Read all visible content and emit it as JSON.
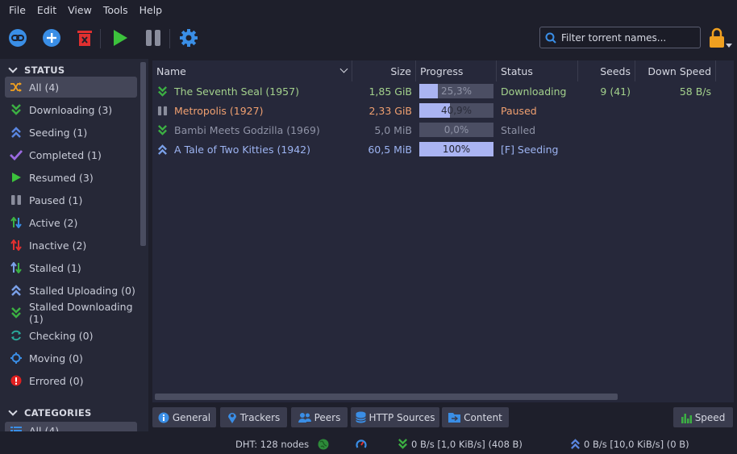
{
  "menu": [
    "File",
    "Edit",
    "View",
    "Tools",
    "Help"
  ],
  "toolbar": {
    "search_placeholder": "Filter torrent names..."
  },
  "sidebar": {
    "status_header": "STATUS",
    "status_items": [
      {
        "label": "All (4)",
        "icon": "shuffle-icon",
        "selected": true
      },
      {
        "label": "Downloading (3)",
        "icon": "download-icon"
      },
      {
        "label": "Seeding (1)",
        "icon": "upload-icon"
      },
      {
        "label": "Completed (1)",
        "icon": "check-icon"
      },
      {
        "label": "Resumed (3)",
        "icon": "play-icon"
      },
      {
        "label": "Paused (1)",
        "icon": "pause-icon"
      },
      {
        "label": "Active (2)",
        "icon": "active-arrows-icon"
      },
      {
        "label": "Inactive (2)",
        "icon": "inactive-arrows-icon"
      },
      {
        "label": "Stalled (1)",
        "icon": "stalled-arrows-icon"
      },
      {
        "label": "Stalled Uploading (0)",
        "icon": "stalled-upload-icon"
      },
      {
        "label": "Stalled Downloading (1)",
        "icon": "stalled-download-icon"
      },
      {
        "label": "Checking (0)",
        "icon": "checking-icon"
      },
      {
        "label": "Moving (0)",
        "icon": "moving-icon"
      },
      {
        "label": "Errored (0)",
        "icon": "error-icon"
      }
    ],
    "categories_header": "CATEGORIES",
    "categories_items": [
      {
        "label": "All (4)"
      }
    ]
  },
  "table": {
    "columns": [
      "Name",
      "Size",
      "Progress",
      "Status",
      "Seeds",
      "Down Speed"
    ],
    "rows": [
      {
        "name": "The Seventh Seal (1957)",
        "size": "1,85 GiB",
        "progress": 0.253,
        "progress_text": "25,3%",
        "status": "Downloading",
        "seeds": "9 (41)",
        "down_speed": "58 B/s",
        "color": "#a3d18c",
        "icon": "download-icon"
      },
      {
        "name": "Metropolis (1927)",
        "size": "2,33 GiB",
        "progress": 0.409,
        "progress_text": "40,9%",
        "status": "Paused",
        "seeds": "",
        "down_speed": "",
        "color": "#f0a070",
        "icon": "pause-icon"
      },
      {
        "name": "Bambi Meets Godzilla (1969)",
        "size": "5,0 MiB",
        "progress": 0.0,
        "progress_text": "0,0%",
        "status": "Stalled",
        "seeds": "",
        "down_speed": "",
        "color": "#8f93a6",
        "icon": "stalled-download-icon"
      },
      {
        "name": "A Tale of Two Kitties (1942)",
        "size": "60,5 MiB",
        "progress": 1.0,
        "progress_text": "100%",
        "status": "[F] Seeding",
        "seeds": "",
        "down_speed": "",
        "color": "#9db4f2",
        "icon": "upload-icon"
      }
    ]
  },
  "tabs": [
    "General",
    "Trackers",
    "Peers",
    "HTTP Sources",
    "Content"
  ],
  "speed_button": "Speed",
  "statusbar": {
    "dht": "DHT: 128 nodes",
    "download": "0 B/s [1,0 KiB/s] (408 B)",
    "upload": "0 B/s [10,0 KiB/s] (0 B)"
  },
  "colors": {
    "accent_blue": "#3a8ee6",
    "play_green": "#3cc23c",
    "delete_red": "#e03030",
    "lock_orange": "#f0a020"
  }
}
